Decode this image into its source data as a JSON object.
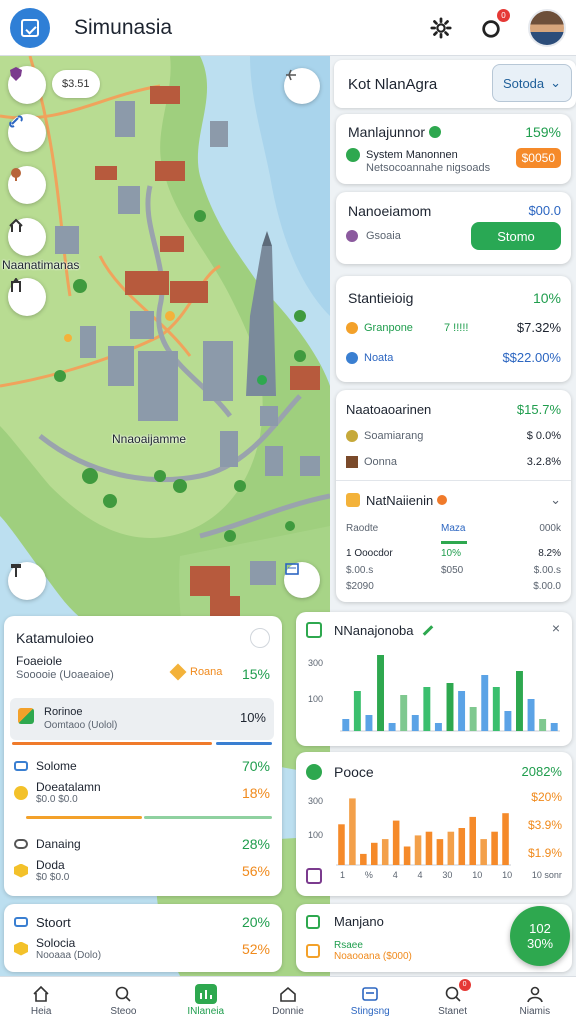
{
  "header": {
    "app_title": "Simunasia",
    "icons": [
      "app-logo-icon",
      "gear-icon",
      "notification-icon"
    ],
    "notif_count": "0"
  },
  "map": {
    "chip_value": "$3.51",
    "label_district": "Naanatimanas",
    "label_center": "Nnaoaijamme",
    "controls_left": [
      "shield-icon",
      "link-icon",
      "pin-icon",
      "home-icon",
      "gate-icon"
    ],
    "control_bottom": "hammer-icon",
    "control_right_top": "compass-icon",
    "control_right_bottom": "layers-icon"
  },
  "panel_header": {
    "title": "Kot NlanAgra",
    "dropdown_value": "Sotoda"
  },
  "card1": {
    "title": "Manlajunnor",
    "percent": "159%",
    "sub1": "System Manonnen",
    "sub2": "Netsocoannahe nigsoads",
    "pill": "$0050"
  },
  "card2": {
    "title": "Nanoeiamom",
    "value": "$00.0",
    "sub": "Gsoaia",
    "button": "Stomo"
  },
  "card3": {
    "title": "Stantieioig",
    "percent": "10%",
    "rows": [
      {
        "label": "Granpone",
        "mid": "7 !!!!!",
        "value": "$7.32%"
      },
      {
        "label": "Noata",
        "mid": "",
        "value": "$$22.00%"
      }
    ]
  },
  "card4": {
    "title": "Naatoaoarinen",
    "value": "$15.7%",
    "rows": [
      {
        "label": "Soamiarang",
        "value": "$ 0.0%"
      },
      {
        "label": "Oonna",
        "value": "3.2.8%"
      }
    ],
    "section_title": "NatNaiienin",
    "table": {
      "header": [
        "Raodte",
        "Maza",
        "000k"
      ],
      "rows": [
        [
          "1 Ooocdor",
          "10%",
          "8.2%"
        ],
        [
          "$.00.s",
          "$050",
          "$.00.s"
        ],
        [
          "$2090",
          "",
          "$.00.0"
        ]
      ]
    }
  },
  "left_card1": {
    "title": "Katamuloieo",
    "sub_title": "Foaeiole",
    "subtitle_line": "Sooooie (Uoaeaioe)",
    "tag": "Roana",
    "percent": "15%",
    "selected_item": {
      "title": "Rorinoe",
      "sub": "Oomtaoo (Uolol)",
      "percent": "10%"
    },
    "items": [
      {
        "title": "Solome",
        "percent": "70%"
      },
      {
        "title": "Doeatalamn",
        "sub": "$0.0 $0.0",
        "percent": "18%"
      },
      {
        "title": "Danaing",
        "percent": "28%"
      },
      {
        "title": "Doda",
        "sub": "$0 $0.0",
        "percent": "56%"
      }
    ]
  },
  "left_card2": {
    "title": "Stoort",
    "percent": "20%",
    "item": "Solocia",
    "sub": "Nooaaa (Dolo)",
    "item_percent": "52%"
  },
  "chart_panel1": {
    "title": "NNanajonoba",
    "y_ticks": [
      "300",
      "100"
    ]
  },
  "chart_panel2": {
    "title": "Pooce",
    "percent": "2082%",
    "y_ticks": [
      "300",
      "100"
    ],
    "x_ticks": [
      "1",
      "%",
      "4",
      "4",
      "30",
      "10",
      "10",
      "10 sonr"
    ],
    "side_values": [
      "$20%",
      "$3.9%",
      "$1.9%"
    ]
  },
  "bottom_right_card": {
    "title": "Manjano",
    "sub1": "Rsaee",
    "sub2": "Noaooana ($000)"
  },
  "fab": {
    "line1": "102",
    "line2": "30%"
  },
  "chart_data": [
    {
      "type": "bar",
      "title": "NNanajonoba",
      "series": [
        {
          "values": [
            0.15,
            0.5,
            0.2,
            0.95,
            0.1,
            0.45,
            0.2,
            0.55,
            0.1,
            0.6,
            0.5,
            0.3,
            0.7,
            0.55,
            0.25,
            0.75,
            0.4,
            0.15,
            0.1
          ]
        }
      ]
    },
    {
      "type": "bar",
      "title": "Pooce",
      "series": [
        {
          "values": [
            0.55,
            0.9,
            0.15,
            0.3,
            0.35,
            0.6,
            0.25,
            0.4,
            0.45,
            0.35,
            0.45,
            0.5,
            0.65,
            0.35,
            0.45,
            0.7
          ]
        }
      ]
    }
  ]
}
